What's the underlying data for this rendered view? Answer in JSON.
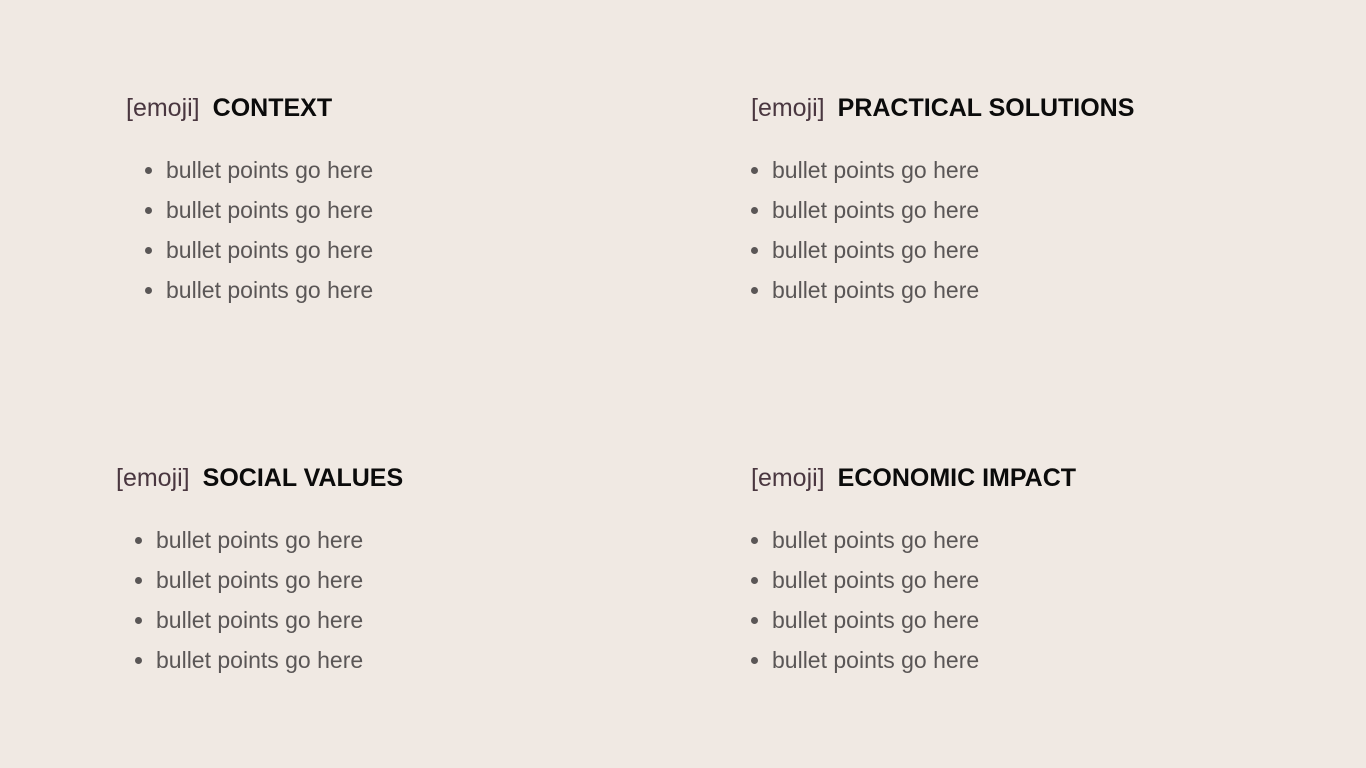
{
  "colors": {
    "background": "#F0E9E3",
    "emoji_tag": "#4A3740",
    "title": "#0B0B0B",
    "bullet_text": "#5A5656"
  },
  "sections": [
    {
      "emoji_placeholder": "[emoji]",
      "title": "CONTEXT",
      "bullets": [
        "bullet points go here",
        "bullet points go here",
        "bullet points go here",
        "bullet points go here"
      ]
    },
    {
      "emoji_placeholder": "[emoji]",
      "title": "PRACTICAL SOLUTIONS",
      "bullets": [
        "bullet points go here",
        "bullet points go here",
        "bullet points go here",
        "bullet points go here"
      ]
    },
    {
      "emoji_placeholder": "[emoji]",
      "title": "SOCIAL VALUES",
      "bullets": [
        "bullet points go here",
        "bullet points go here",
        "bullet points go here",
        "bullet points go here"
      ]
    },
    {
      "emoji_placeholder": "[emoji]",
      "title": "ECONOMIC IMPACT",
      "bullets": [
        "bullet points go here",
        "bullet points go here",
        "bullet points go here",
        "bullet points go here"
      ]
    }
  ]
}
